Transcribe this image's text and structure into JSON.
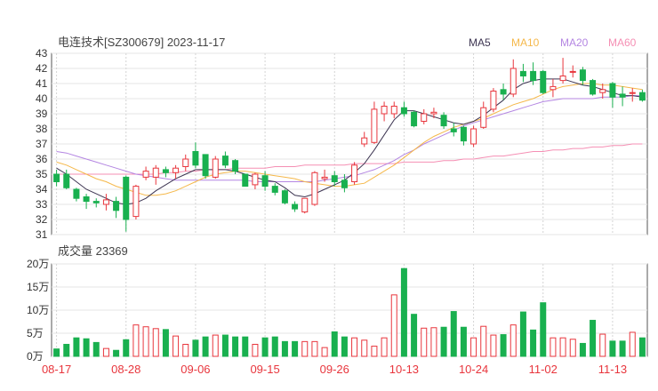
{
  "chart_data": [
    {
      "type": "candlestick",
      "title": "电连技术[SZ300679] 2023-11-17",
      "ylim": [
        31,
        43
      ],
      "yticks": [
        31,
        32,
        33,
        34,
        35,
        36,
        37,
        38,
        39,
        40,
        41,
        42,
        43
      ],
      "legend": [
        {
          "name": "MA5",
          "color": "#3d3552"
        },
        {
          "name": "MA10",
          "color": "#f5b84a"
        },
        {
          "name": "MA20",
          "color": "#b486e2"
        },
        {
          "name": "MA60",
          "color": "#f58fb4"
        }
      ],
      "up_color": "#e8363d",
      "down_color": "#19b04f",
      "candles": [
        [
          35.0,
          34.5,
          35.3,
          34.2
        ],
        [
          35.0,
          34.1,
          35.3,
          34.0
        ],
        [
          34.0,
          33.4,
          34.1,
          33.2
        ],
        [
          33.5,
          33.2,
          33.7,
          32.7
        ],
        [
          33.2,
          33.1,
          33.4,
          32.8
        ],
        [
          33.0,
          33.3,
          33.7,
          32.6
        ],
        [
          33.2,
          32.6,
          33.5,
          32.1
        ],
        [
          34.8,
          32.0,
          34.9,
          31.2
        ],
        [
          32.2,
          34.2,
          34.3,
          32.0
        ],
        [
          34.8,
          35.2,
          35.5,
          34.6
        ],
        [
          34.8,
          35.4,
          35.6,
          34.3
        ],
        [
          35.3,
          35.1,
          35.5,
          34.8
        ],
        [
          35.1,
          35.4,
          35.6,
          34.7
        ],
        [
          35.5,
          36.0,
          36.3,
          35.2
        ],
        [
          36.5,
          35.6,
          37.1,
          35.4
        ],
        [
          36.3,
          34.9,
          36.3,
          34.7
        ],
        [
          34.8,
          36.0,
          36.2,
          34.7
        ],
        [
          36.2,
          35.6,
          36.5,
          35.4
        ],
        [
          35.9,
          35.2,
          36.0,
          35.0
        ],
        [
          35.0,
          34.2,
          35.0,
          34.2
        ],
        [
          34.3,
          35.0,
          35.1,
          34.0
        ],
        [
          34.9,
          34.2,
          35.2,
          33.9
        ],
        [
          34.2,
          33.8,
          34.4,
          33.6
        ],
        [
          33.9,
          33.1,
          34.0,
          33.0
        ],
        [
          33.0,
          32.7,
          33.2,
          32.5
        ],
        [
          32.5,
          33.4,
          33.4,
          32.4
        ],
        [
          33.0,
          35.1,
          35.2,
          32.9
        ],
        [
          34.7,
          34.8,
          35.3,
          34.5
        ],
        [
          34.9,
          34.5,
          35.2,
          34.2
        ],
        [
          34.6,
          34.1,
          35.0,
          33.8
        ],
        [
          34.5,
          35.6,
          35.8,
          34.3
        ],
        [
          37.0,
          37.4,
          37.8,
          36.8
        ],
        [
          37.1,
          39.3,
          39.8,
          37.0
        ],
        [
          39.0,
          39.5,
          39.8,
          38.5
        ],
        [
          39.0,
          39.5,
          39.8,
          38.7
        ],
        [
          39.4,
          39.0,
          39.8,
          38.8
        ],
        [
          39.1,
          38.2,
          39.2,
          38.1
        ],
        [
          38.5,
          39.0,
          39.3,
          38.3
        ],
        [
          39.0,
          39.1,
          39.4,
          38.7
        ],
        [
          38.9,
          38.2,
          39.1,
          38.0
        ],
        [
          38.0,
          37.8,
          38.4,
          37.5
        ],
        [
          38.1,
          37.2,
          38.2,
          36.9
        ],
        [
          37.0,
          38.0,
          38.2,
          36.8
        ],
        [
          38.1,
          39.4,
          39.8,
          38.0
        ],
        [
          39.3,
          40.5,
          40.7,
          39.1
        ],
        [
          40.6,
          40.3,
          41.0,
          39.9
        ],
        [
          40.3,
          42.0,
          42.6,
          40.1
        ],
        [
          41.8,
          41.5,
          42.3,
          41.1
        ],
        [
          41.8,
          41.2,
          42.4,
          40.9
        ],
        [
          41.8,
          40.4,
          41.9,
          40.3
        ],
        [
          40.6,
          40.8,
          41.3,
          40.1
        ],
        [
          41.2,
          41.5,
          42.7,
          41.0
        ],
        [
          41.8,
          41.8,
          42.2,
          41.4
        ],
        [
          41.9,
          41.2,
          42.1,
          40.9
        ],
        [
          41.2,
          40.3,
          41.3,
          40.2
        ],
        [
          40.4,
          40.6,
          41.0,
          40.0
        ],
        [
          41.0,
          40.1,
          41.1,
          39.4
        ],
        [
          40.3,
          40.1,
          40.8,
          39.5
        ],
        [
          40.4,
          40.4,
          40.7,
          39.8
        ],
        [
          40.4,
          39.9,
          40.6,
          39.8
        ]
      ],
      "ma5": [
        35.4,
        35.0,
        34.5,
        34.0,
        33.7,
        33.4,
        33.1,
        33.0,
        33.1,
        33.4,
        33.9,
        34.3,
        34.7,
        35.0,
        35.3,
        35.3,
        35.3,
        35.3,
        35.2,
        35.0,
        34.8,
        34.6,
        34.5,
        34.1,
        33.6,
        33.5,
        33.7,
        34.0,
        34.3,
        34.6,
        35.1,
        35.7,
        36.6,
        37.6,
        38.6,
        39.2,
        39.2,
        39.0,
        38.8,
        38.6,
        38.4,
        38.3,
        38.5,
        38.9,
        39.4,
        39.9,
        40.6,
        41.0,
        41.2,
        41.3,
        41.3,
        41.3,
        41.1,
        40.9,
        40.8,
        40.6,
        40.4,
        40.2,
        40.2,
        40.1
      ],
      "ma10": [
        35.8,
        35.6,
        35.3,
        35.0,
        34.7,
        34.5,
        34.2,
        34.0,
        33.8,
        33.6,
        33.6,
        33.7,
        33.9,
        34.2,
        34.5,
        34.8,
        35.0,
        35.1,
        35.2,
        35.2,
        35.1,
        35.0,
        34.9,
        34.8,
        34.7,
        34.5,
        34.4,
        34.3,
        34.2,
        34.2,
        34.3,
        34.4,
        34.8,
        35.2,
        35.6,
        36.1,
        36.6,
        37.1,
        37.5,
        37.8,
        38.1,
        38.3,
        38.5,
        38.7,
        39.0,
        39.3,
        39.6,
        39.8,
        40.0,
        40.3,
        40.6,
        40.8,
        40.9,
        41.0,
        41.0,
        40.9,
        40.9,
        40.8,
        40.7,
        40.6
      ],
      "ma20": [
        36.5,
        36.4,
        36.2,
        36.0,
        35.8,
        35.6,
        35.4,
        35.2,
        35.0,
        34.9,
        34.8,
        34.7,
        34.6,
        34.6,
        34.6,
        34.6,
        34.6,
        34.6,
        34.6,
        34.6,
        34.5,
        34.5,
        34.5,
        34.5,
        34.5,
        34.5,
        34.5,
        34.6,
        34.7,
        34.8,
        34.9,
        35.1,
        35.3,
        35.6,
        35.9,
        36.3,
        36.6,
        37.0,
        37.3,
        37.6,
        37.9,
        38.2,
        38.4,
        38.6,
        38.8,
        39.0,
        39.2,
        39.4,
        39.6,
        39.8,
        39.9,
        40.0,
        40.0,
        40.0,
        40.0,
        40.1,
        40.1,
        40.1,
        40.2,
        40.2
      ],
      "ma60": [
        35.0,
        35.0,
        35.0,
        35.0,
        35.0,
        35.0,
        35.0,
        35.0,
        35.0,
        35.0,
        35.0,
        35.1,
        35.1,
        35.2,
        35.2,
        35.3,
        35.3,
        35.3,
        35.4,
        35.4,
        35.4,
        35.4,
        35.5,
        35.5,
        35.5,
        35.6,
        35.6,
        35.6,
        35.6,
        35.6,
        35.7,
        35.7,
        35.7,
        35.7,
        35.7,
        35.8,
        35.8,
        35.8,
        35.8,
        35.9,
        35.9,
        36.0,
        36.0,
        36.1,
        36.2,
        36.2,
        36.3,
        36.4,
        36.5,
        36.5,
        36.6,
        36.6,
        36.7,
        36.7,
        36.8,
        36.8,
        36.9,
        36.9,
        37.0,
        37.0
      ]
    },
    {
      "type": "bar",
      "title": "成交量 23369",
      "ylim": [
        0,
        20
      ],
      "ytick_values": [
        0,
        5,
        10,
        15,
        20
      ],
      "ytick_labels": [
        "0万",
        "5万",
        "10万",
        "15万",
        "20万"
      ],
      "x_tick_labels": [
        "08-17",
        "08-28",
        "09-06",
        "09-15",
        "09-26",
        "10-13",
        "10-24",
        "11-02",
        "11-13"
      ],
      "x_tick_index": [
        0,
        7,
        14,
        21,
        28,
        35,
        42,
        49,
        56
      ],
      "volumes": [
        1.6,
        2.6,
        4.0,
        3.8,
        3.0,
        1.7,
        1.3,
        3.6,
        6.8,
        6.4,
        6.0,
        5.8,
        4.4,
        2.6,
        3.5,
        4.2,
        4.6,
        4.6,
        4.2,
        4.2,
        2.6,
        4.0,
        4.2,
        3.2,
        3.2,
        3.2,
        3.2,
        1.9,
        5.3,
        4.2,
        4.0,
        3.5,
        2.2,
        4.0,
        13.3,
        19.0,
        9.1,
        6.1,
        6.2,
        6.3,
        9.7,
        6.3,
        4.0,
        6.5,
        4.6,
        4.7,
        6.8,
        9.6,
        5.7,
        11.6,
        4.0,
        4.0,
        3.7,
        2.8,
        7.8,
        4.8,
        3.3,
        3.3,
        5.2,
        4.0
      ],
      "last_volume": 2.6
    }
  ]
}
